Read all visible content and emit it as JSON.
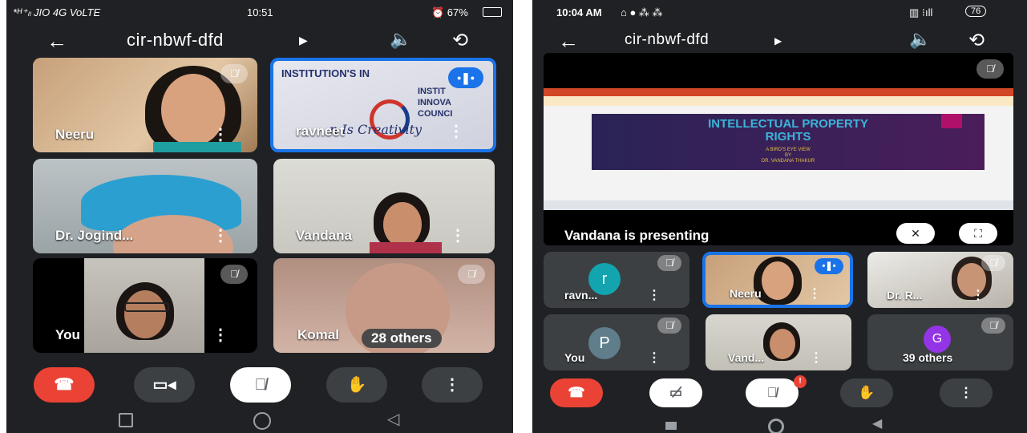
{
  "left": {
    "status": {
      "carrier": "*ᴴ⁺ₗₗ JIO 4G VoLTE",
      "time": "10:51",
      "battery": "⏰ 67%"
    },
    "meeting_code": "cir-nbwf-dfd",
    "participants": [
      "Neeru",
      "ravneet",
      "Dr. Jogind...",
      "Vandana",
      "You",
      "Komal"
    ],
    "others_label": "28 others",
    "banner_text": [
      "INSTITUTION'S IN",
      "INSTIT",
      "INNOVA",
      "COUNCI",
      "n Is Creativity"
    ]
  },
  "right": {
    "status": {
      "time": "10:04 AM",
      "battery": "76"
    },
    "meeting_code": "cir-nbwf-dfd",
    "presentation": {
      "title_line1": "INTELLECTUAL PROPERTY",
      "title_line2": "RIGHTS",
      "subtitle": "A BIRD'S EYE VIEW",
      "by": "BY",
      "author": "DR. VANDANA THAKUR"
    },
    "presenting_label": "Vandana is presenting",
    "participants": [
      "ravn...",
      "Neeru",
      "Dr. R...",
      "You",
      "Vand...",
      "G"
    ],
    "avatar_letters": [
      "r",
      "P",
      "G"
    ],
    "others_label": "39 others",
    "notification_count": "!"
  },
  "colors": {
    "bg": "#202124",
    "tile": "#3c4043",
    "active": "#1a73e8",
    "end_call": "#ea4335",
    "teal": "#12a4af",
    "purple": "#9334e6"
  }
}
